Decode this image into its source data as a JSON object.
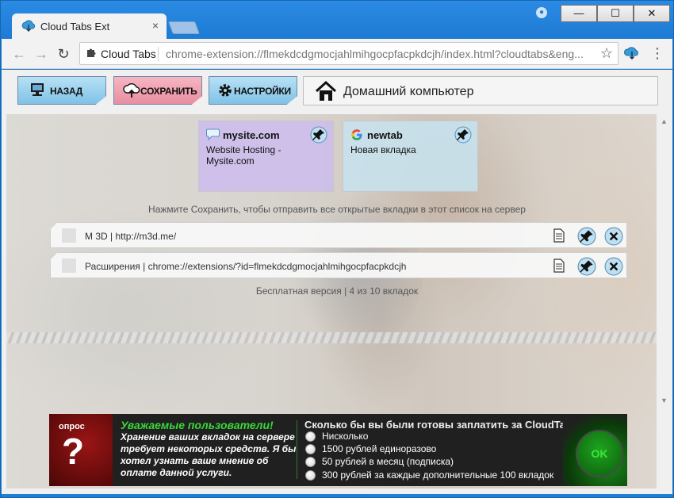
{
  "browser": {
    "tab_title": "Cloud Tabs Ext",
    "tab_close": "×",
    "window_controls": {
      "minimize": "—",
      "maximize": "☐",
      "close": "✕"
    },
    "omnibox": {
      "chip_label": "Cloud Tabs",
      "url": "chrome-extension://flmekdcdgmocjahlmihgocpfacpkdcjh/index.html?cloudtabs&eng..."
    },
    "nav": {
      "back": "←",
      "forward": "→",
      "reload": "↻"
    },
    "menu": "⋮",
    "star": "☆"
  },
  "toolbar": {
    "back_label": "НАЗАД",
    "save_label": "СОХРАНИТЬ",
    "settings_label": "НАСТРОЙКИ",
    "device_name": "Домашний компьютер"
  },
  "cloud_tabs": [
    {
      "title": "mysite.com",
      "description": "Website Hosting - Mysite.com",
      "icon": "speech-bubble-icon",
      "color": "#cdbeeb"
    },
    {
      "title": "newtab",
      "description": "Новая вкладка",
      "icon": "google-icon",
      "color": "#c8e1eb"
    }
  ],
  "hint": "Нажмите Сохранить, чтобы отправить все открытые вкладки в этот список на сервер",
  "open_tabs": [
    {
      "text": "M 3D  |  http://m3d.me/"
    },
    {
      "text": "Расширения  |  chrome://extensions/?id=flmekdcdgmocjahlmihgocpfacpkdcjh"
    }
  ],
  "status": "Бесплатная версия | 4 из 10 вкладок",
  "survey": {
    "badge": "опрос",
    "badge_symbol": "?",
    "heading": "Уважаемые пользователи!",
    "body": "Хранение ваших вкладок на сервере требует некоторых средств. Я бы хотел узнать ваше мнение об оплате данной услуги.",
    "question": "Сколько бы вы были готовы заплатить за CloudTabs ?",
    "options": [
      "Нисколько",
      "1500 рублей единоразово",
      "50 рублей в месяц (подписка)",
      "300 рублей за каждые дополнительные 100 вкладок"
    ],
    "ok_label": "OK"
  }
}
